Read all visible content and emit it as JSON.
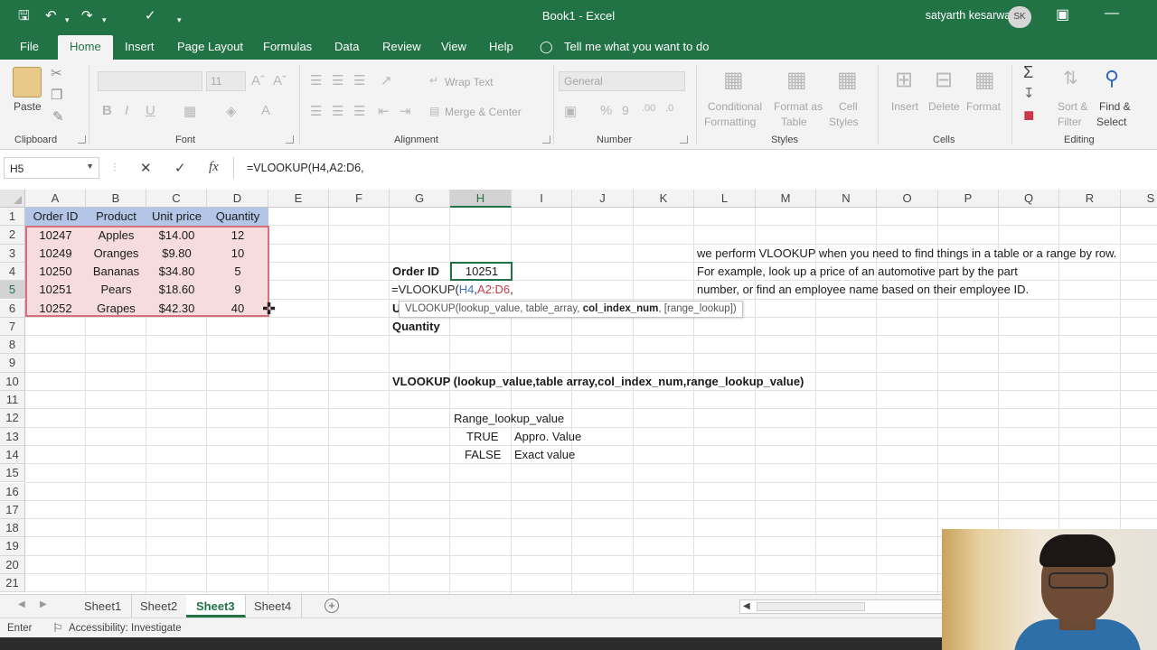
{
  "window": {
    "title": "Book1  -  Excel",
    "user_name": "satyarth kesarwani",
    "user_initials": "SK"
  },
  "menu": {
    "items": [
      "File",
      "Home",
      "Insert",
      "Page Layout",
      "Formulas",
      "Data",
      "Review",
      "View",
      "Help"
    ],
    "active": "Home",
    "tell_me": "Tell me what you want to do"
  },
  "ribbon": {
    "clipboard": {
      "paste": "Paste",
      "label": "Clipboard"
    },
    "font": {
      "size": "11",
      "bold": "B",
      "italic": "I",
      "underline": "U",
      "label": "Font"
    },
    "alignment": {
      "wrap_text": "Wrap Text",
      "merge_center": "Merge & Center",
      "label": "Alignment"
    },
    "number": {
      "format": "General",
      "label": "Number"
    },
    "styles": {
      "conditional_1": "Conditional",
      "conditional_2": "Formatting",
      "format_table_1": "Format as",
      "format_table_2": "Table",
      "cell_styles_1": "Cell",
      "cell_styles_2": "Styles",
      "label": "Styles"
    },
    "cells": {
      "insert": "Insert",
      "delete": "Delete",
      "format": "Format",
      "label": "Cells"
    },
    "editing": {
      "sort_1": "Sort &",
      "sort_2": "Filter",
      "find_1": "Find &",
      "find_2": "Select",
      "label": "Editing"
    }
  },
  "formula_bar": {
    "name_box": "H5",
    "formula": "=VLOOKUP(H4,A2:D6,"
  },
  "columns": [
    "A",
    "B",
    "C",
    "D",
    "E",
    "F",
    "G",
    "H",
    "I",
    "J",
    "K",
    "L",
    "M",
    "N",
    "O",
    "P",
    "Q",
    "R",
    "S"
  ],
  "rows": [
    "1",
    "2",
    "3",
    "4",
    "5",
    "6",
    "7",
    "8",
    "9",
    "10",
    "11",
    "12",
    "13",
    "14",
    "15",
    "16",
    "17",
    "18",
    "19",
    "20",
    "21"
  ],
  "table": {
    "headers": [
      "Order ID",
      "Product",
      "Unit price",
      "Quantity"
    ],
    "rows": [
      [
        "10247",
        "Apples",
        "$14.00",
        "12"
      ],
      [
        "10249",
        "Oranges",
        "$9.80",
        "10"
      ],
      [
        "10250",
        "Bananas",
        "$34.80",
        "5"
      ],
      [
        "10251",
        "Pears",
        "$18.60",
        "9"
      ],
      [
        "10252",
        "Grapes",
        "$42.30",
        "40"
      ]
    ]
  },
  "lookup": {
    "order_id_label": "Order ID",
    "order_id_value": "10251",
    "edit_prefix": "=VLOOKUP(",
    "edit_arg1": "H4",
    "edit_comma": ",",
    "edit_arg2": "A2:D6",
    "edit_suffix": ",",
    "hidden_label_initial": "U",
    "quantity_label": "Quantity"
  },
  "tooltip": {
    "fn": "VLOOKUP(",
    "args_plain": "lookup_value, table_array, ",
    "args_bold": "col_index_num",
    "args_tail": ", [range_lookup])"
  },
  "notes": {
    "line1": "we perform VLOOKUP when you need to find things in a table or a range by row.",
    "line2": "For example, look up a price of an automotive part by the part",
    "line3": "number, or find an employee name based on their employee ID.",
    "syntax": "VLOOKUP (lookup_value,table array,col_index_num,range_lookup_value)",
    "range_lookup_title": "Range_lookup_value",
    "true_label": "TRUE",
    "true_desc": "Appro. Value",
    "false_label": "FALSE",
    "false_desc": "Exact value"
  },
  "sheets": {
    "tabs": [
      "Sheet1",
      "Sheet2",
      "Sheet3",
      "Sheet4"
    ],
    "active": "Sheet3"
  },
  "status": {
    "mode": "Enter",
    "accessibility": "Accessibility: Investigate"
  },
  "colors": {
    "excel_green": "#217346",
    "table_header": "#b4c6e7",
    "range_fill": "#f6dcdc",
    "range_border": "#d8707b"
  }
}
